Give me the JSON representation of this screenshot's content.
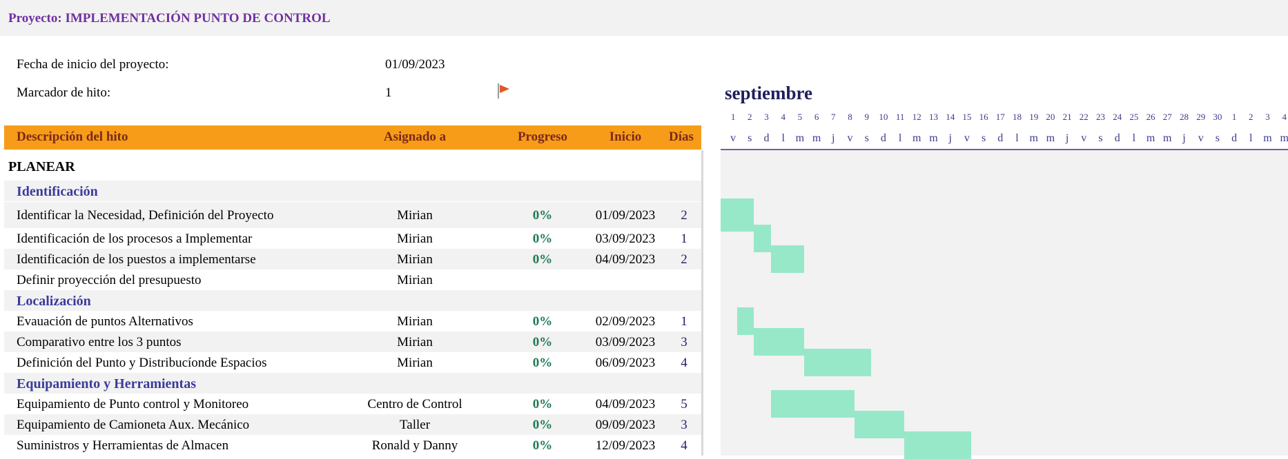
{
  "project_title": "Proyecto: IMPLEMENTACIÓN PUNTO DE CONTROL",
  "info": {
    "start_label": "Fecha de inicio del proyecto:",
    "start_value": "01/09/2023",
    "milestone_label": "Marcador de hito:",
    "milestone_value": "1"
  },
  "columns": {
    "description": "Descripción del hito",
    "assigned": "Asignado a",
    "progress": "Progreso",
    "start": "Inicio",
    "days": "Días"
  },
  "timeline": {
    "month": "septiembre",
    "day_numbers": [
      "1",
      "2",
      "3",
      "4",
      "5",
      "6",
      "7",
      "8",
      "9",
      "10",
      "11",
      "12",
      "13",
      "14",
      "15",
      "16",
      "17",
      "18",
      "19",
      "20",
      "21",
      "22",
      "23",
      "24",
      "25",
      "26",
      "27",
      "28",
      "29",
      "30",
      "1",
      "2",
      "3",
      "4"
    ],
    "day_letters": [
      "v",
      "s",
      "d",
      "l",
      "m",
      "m",
      "j",
      "v",
      "s",
      "d",
      "l",
      "m",
      "m",
      "j",
      "v",
      "s",
      "d",
      "l",
      "m",
      "m",
      "j",
      "v",
      "s",
      "d",
      "l",
      "m",
      "m",
      "j",
      "v",
      "s",
      "d",
      "l",
      "m",
      "m"
    ]
  },
  "colors": {
    "header_bg": "#f79c18",
    "bar": "#97e8c9",
    "title": "#7030a0",
    "subphase": "#3b3b9c",
    "progress": "#1f7a52",
    "flag": "#e05a28"
  },
  "rows": [
    {
      "type": "phase",
      "name": "PLANEAR"
    },
    {
      "type": "subphase",
      "name": "Identificación"
    },
    {
      "type": "task",
      "name": "Identificar la Necesidad, Definición del Proyecto",
      "assigned": "Mirian",
      "progress": "0%",
      "start": "01/09/2023",
      "days": "2",
      "bar_start_day": 1,
      "bar_days": 2
    },
    {
      "type": "task",
      "name": "Identificación de los procesos a Implementar",
      "assigned": "Mirian",
      "progress": "0%",
      "start": "03/09/2023",
      "days": "1",
      "bar_start_day": 3,
      "bar_days": 1
    },
    {
      "type": "task",
      "name": "Identificación de los puestos a implementarse",
      "assigned": "Mirian",
      "progress": "0%",
      "start": "04/09/2023",
      "days": "2",
      "bar_start_day": 4,
      "bar_days": 2
    },
    {
      "type": "task",
      "name": "Definir proyección del presupuesto",
      "assigned": "Mirian",
      "progress": "",
      "start": "",
      "days": ""
    },
    {
      "type": "subphase",
      "name": "Localización"
    },
    {
      "type": "task",
      "name": "Evauación de puntos Alternativos",
      "assigned": "Mirian",
      "progress": "0%",
      "start": "02/09/2023",
      "days": "1",
      "bar_start_day": 2,
      "bar_days": 1
    },
    {
      "type": "task",
      "name": "Comparativo entre los 3 puntos",
      "assigned": "Mirian",
      "progress": "0%",
      "start": "03/09/2023",
      "days": "3",
      "bar_start_day": 3,
      "bar_days": 3
    },
    {
      "type": "task",
      "name": "Definición del Punto y Distribucíonde Espacios",
      "assigned": "Mirian",
      "progress": "0%",
      "start": "06/09/2023",
      "days": "4",
      "bar_start_day": 6,
      "bar_days": 4
    },
    {
      "type": "subphase",
      "name": "Equipamiento y Herramientas"
    },
    {
      "type": "task",
      "name": "Equipamiento de Punto control y Monitoreo",
      "assigned": "Centro de Control",
      "progress": "0%",
      "start": "04/09/2023",
      "days": "5",
      "bar_start_day": 4,
      "bar_days": 5
    },
    {
      "type": "task",
      "name": "Equipamiento de Camioneta Aux. Mecánico",
      "assigned": "Taller",
      "progress": "0%",
      "start": "09/09/2023",
      "days": "3",
      "bar_start_day": 9,
      "bar_days": 3
    },
    {
      "type": "task",
      "name": "Suministros y Herramientas de Almacen",
      "assigned": "Ronald y Danny",
      "progress": "0%",
      "start": "12/09/2023",
      "days": "4",
      "bar_start_day": 12,
      "bar_days": 4
    }
  ]
}
